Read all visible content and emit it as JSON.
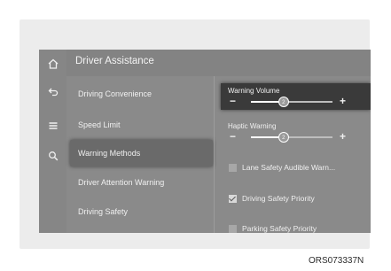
{
  "header": {
    "title": "Driver Assistance"
  },
  "rail": {
    "icons": [
      "home-icon",
      "back-icon",
      "menu-icon",
      "search-icon"
    ]
  },
  "menu": {
    "items": [
      {
        "label": "Driving Convenience",
        "selected": false
      },
      {
        "label": "Speed Limit",
        "selected": false
      },
      {
        "label": "Warning Methods",
        "selected": true
      },
      {
        "label": "Driver Attention Warning",
        "selected": false
      },
      {
        "label": "Driving Safety",
        "selected": false
      }
    ]
  },
  "settings": {
    "warning_volume": {
      "label": "Warning Volume",
      "value": "2",
      "minus": "−",
      "plus": "+",
      "level_fraction": 0.4
    },
    "haptic_warning": {
      "label": "Haptic Warning",
      "value": "2",
      "minus": "−",
      "plus": "+",
      "level_fraction": 0.4
    },
    "checks": [
      {
        "label": "Lane Safety Audible Warn...",
        "checked": false
      },
      {
        "label": "Driving Safety Priority",
        "checked": true
      },
      {
        "label": "Parking Safety Priority",
        "checked": false
      }
    ]
  },
  "caption": "ORS073337N",
  "colors": {
    "screen_bg": "#8a8a8a",
    "selected_bg": "#3a3a3a",
    "text": "#f0f0f0"
  }
}
